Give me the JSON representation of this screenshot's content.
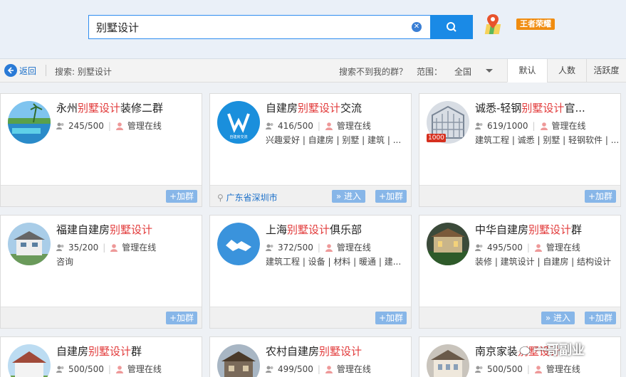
{
  "search": {
    "value": "别墅设计",
    "clear_icon": "clear-icon",
    "button_icon": "search-icon"
  },
  "header": {
    "map_icon": "map-pin-icon",
    "game_badge": "王者荣耀"
  },
  "toolbar": {
    "back_label": "返回",
    "search_crumb": "搜索: 别墅设计",
    "not_found": "搜索不到我的群？",
    "range_label": "范围：",
    "range_value": "全国",
    "sort_tabs": [
      "默认",
      "人数",
      "活跃度"
    ]
  },
  "cards": [
    {
      "title_pre": "永州",
      "title_hl": "别墅设计",
      "title_post": "装修二群",
      "members": "245/500",
      "admin": "管理在线",
      "tags": "",
      "location": "",
      "enter": "",
      "join": "+加群"
    },
    {
      "title_pre": "自建房",
      "title_hl": "别墅设计",
      "title_post": "交流",
      "members": "416/500",
      "admin": "管理在线",
      "tags": "兴趣爱好 | 自建房 | 别墅 | 建筑 | ...",
      "location": "广东省深圳市",
      "enter": "» 进入",
      "join": "+加群"
    },
    {
      "title_pre": "诚悉-轻钢",
      "title_hl": "别墅设计",
      "title_post": "官...",
      "members": "619/1000",
      "admin": "管理在线",
      "tags": "建筑工程 | 诚悉 | 别墅 | 轻钢软件 | ...",
      "location": "",
      "enter": "",
      "join": "+加群",
      "badge": "1000"
    },
    {
      "title_pre": "福建自建房",
      "title_hl": "别墅设计",
      "title_post": "",
      "members": "35/200",
      "admin": "管理在线",
      "tags": "咨询",
      "location": "",
      "enter": "",
      "join": "+加群"
    },
    {
      "title_pre": "上海",
      "title_hl": "别墅设计",
      "title_post": "俱乐部",
      "members": "372/500",
      "admin": "管理在线",
      "tags": "建筑工程 | 设备 | 材料 | 暖通 | 建...",
      "location": "",
      "enter": "",
      "join": "+加群"
    },
    {
      "title_pre": "中华自建房",
      "title_hl": "别墅设计",
      "title_post": "群",
      "members": "495/500",
      "admin": "管理在线",
      "tags": "装修 | 建筑设计 | 自建房 | 结构设计",
      "location": "",
      "enter": "» 进入",
      "join": "+加群"
    },
    {
      "title_pre": "自建房",
      "title_hl": "别墅设计",
      "title_post": "群",
      "members": "500/500",
      "admin": "管理在线",
      "tags": "",
      "location": "",
      "enter": "",
      "join": ""
    },
    {
      "title_pre": "农村自建房",
      "title_hl": "别墅设计",
      "title_post": "",
      "members": "499/500",
      "admin": "管理在线",
      "tags": "",
      "location": "",
      "enter": "",
      "join": ""
    },
    {
      "title_pre": "南京家装",
      "title_hl": "别墅设计",
      "title_post": "",
      "members": "500/500",
      "admin": "管理在线",
      "tags": "",
      "location": "",
      "enter": "",
      "join": ""
    }
  ],
  "watermark": "一哥副业"
}
